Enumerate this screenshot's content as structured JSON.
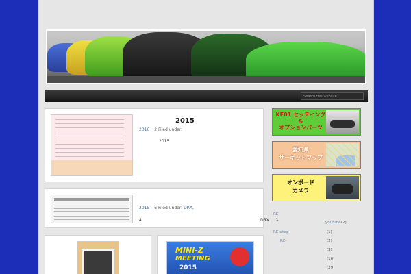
{
  "search": {
    "placeholder": "Search this website..."
  },
  "posts": [
    {
      "title": "2015",
      "meta_date": "2016",
      "meta_num": "2",
      "meta_filed": "Filed under:",
      "body": "2015"
    },
    {
      "meta_date": "2015",
      "meta_num": "6",
      "meta_filed": "Filed under:",
      "meta_cat": "DRX",
      "meta_sep": ",",
      "count": "4",
      "tag": "DRX"
    },
    {
      "poster_line1": "MINI-Z",
      "poster_line2": "MEETING",
      "poster_line3": "2015"
    }
  ],
  "sidebar": {
    "banners": [
      {
        "line1": "KF01 セッティング",
        "line2": "&",
        "line3": "オプションパーツ"
      },
      {
        "line1": "愛知県",
        "line2": "サーキットマップ"
      },
      {
        "line1": "オンボード",
        "line2": "カメラ"
      }
    ],
    "list_header": "RC",
    "rows": [
      {
        "label": "1",
        "link": "youtube",
        "count": "(2)"
      },
      {
        "label": "RC-shop",
        "count": "(1)"
      },
      {
        "label": "RC-",
        "count": "(2)"
      },
      {
        "label": "",
        "count": "(3)"
      },
      {
        "label": "",
        "count": "(16)"
      },
      {
        "label": "",
        "count": "(29)"
      }
    ]
  },
  "colors": {
    "background": "#1c2eb8",
    "page": "#e6e6e6",
    "banner_green": "#5fcc3a",
    "banner_peach": "#f6c59a",
    "banner_yellow": "#fff27a",
    "link": "#3b6ea8"
  }
}
